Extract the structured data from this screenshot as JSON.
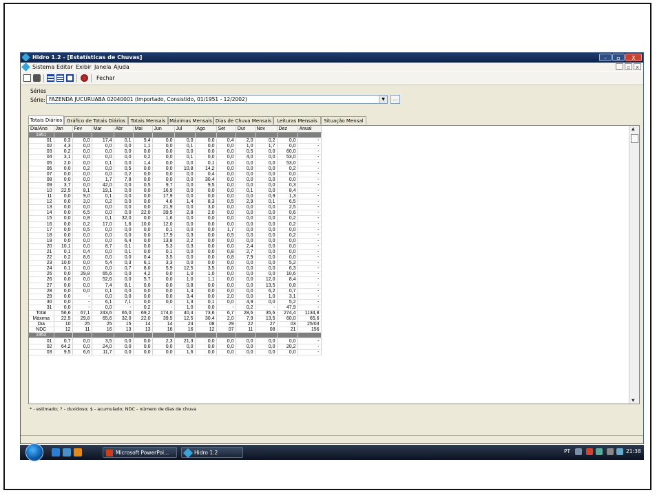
{
  "window": {
    "title": "Hidro 1.2 - [Estatísticas de Chuvas]",
    "controls": {
      "minimize": "–",
      "maximize": "▫",
      "close": "X"
    }
  },
  "menu": {
    "items": [
      "Sistema",
      "Editar",
      "Exibir",
      "Janela",
      "Ajuda"
    ],
    "mdi_controls": [
      "_",
      "▫",
      "x"
    ]
  },
  "toolbar": {
    "icons": [
      "preview-icon",
      "print-icon",
      "copy-icon",
      "grid-icon",
      "columns-icon",
      "chart-icon"
    ],
    "fechar_label": "Fechar"
  },
  "series": {
    "group_label": "Séries",
    "serie_label": "Série:",
    "serie_value": "FAZENDA JUCURUABA 02040001 (Importado, Consistido, 01/1951 - 12/2002)",
    "browse_label": "..."
  },
  "tabs": [
    "Totais Diários",
    "Gráfico de Totais Diários",
    "Totais Mensais",
    "Máximas Mensais",
    "Dias de Chuva Mensais",
    "Leituras Mensais",
    "Situação Mensal"
  ],
  "active_tab": 0,
  "table": {
    "headers": [
      "Dia/Ano",
      "Jan",
      "Fev",
      "Mar",
      "Abr",
      "Mai",
      "Jun",
      "Jul",
      "Ago",
      "Set",
      "Out",
      "Nov",
      "Dez",
      "Anual"
    ],
    "year1": "1951",
    "year1_rows": [
      [
        "01",
        "0,3",
        "0,0",
        "17,4",
        "0,1",
        "9,4",
        "0,0",
        "0,0",
        "0,0",
        "0,4",
        "2,0",
        "0,2",
        "0,0",
        "-"
      ],
      [
        "02",
        "4,3",
        "0,0",
        "0,0",
        "0,0",
        "1,1",
        "0,0",
        "0,1",
        "0,0",
        "0,0",
        "1,0",
        "1,7",
        "0,0",
        "-"
      ],
      [
        "03",
        "0,2",
        "0,0",
        "0,0",
        "0,0",
        "0,0",
        "0,0",
        "0,0",
        "0,0",
        "0,0",
        "0,5",
        "0,0",
        "60,0",
        "-"
      ],
      [
        "04",
        "3,1",
        "0,0",
        "0,0",
        "0,0",
        "0,2",
        "0,0",
        "0,1",
        "0,0",
        "0,0",
        "4,0",
        "0,0",
        "53,0",
        "-"
      ],
      [
        "05",
        "2,0",
        "0,0",
        "0,1",
        "0,0",
        "1,4",
        "0,0",
        "0,0",
        "0,1",
        "0,0",
        "0,0",
        "0,0",
        "53,0",
        "-"
      ],
      [
        "06",
        "0,0",
        "0,2",
        "0,0",
        "0,5",
        "0,0",
        "0,0",
        "10,8",
        "14,2",
        "0,0",
        "0,0",
        "0,0",
        "0,2",
        "-"
      ],
      [
        "07",
        "0,0",
        "0,0",
        "0,0",
        "0,2",
        "0,0",
        "0,0",
        "0,0",
        "0,4",
        "0,0",
        "0,0",
        "0,0",
        "0,0",
        "-"
      ],
      [
        "08",
        "0,0",
        "0,0",
        "1,7",
        "7,8",
        "0,0",
        "0,0",
        "0,0",
        "30,4",
        "0,0",
        "0,0",
        "0,0",
        "0,0",
        "-"
      ],
      [
        "09",
        "3,7",
        "0,0",
        "42,0",
        "0,0",
        "0,5",
        "9,7",
        "0,0",
        "9,5",
        "0,0",
        "0,0",
        "0,0",
        "0,3",
        "-"
      ],
      [
        "10",
        "22,5",
        "8,1",
        "19,1",
        "0,0",
        "0,0",
        "16,9",
        "0,0",
        "0,0",
        "0,0",
        "0,1",
        "0,0",
        "8,4",
        "-"
      ],
      [
        "11",
        "0,0",
        "9,0",
        "0,1",
        "0,0",
        "0,0",
        "17,9",
        "0,0",
        "0,0",
        "0,0",
        "0,0",
        "0,9",
        "1,3",
        "-"
      ],
      [
        "12",
        "0,0",
        "3,0",
        "0,2",
        "0,0",
        "0,0",
        "4,6",
        "1,4",
        "8,3",
        "0,5",
        "2,9",
        "0,1",
        "6,5",
        "-"
      ],
      [
        "13",
        "0,0",
        "0,0",
        "0,0",
        "0,0",
        "0,0",
        "21,9",
        "0,0",
        "3,0",
        "0,0",
        "0,0",
        "0,0",
        "2,5",
        "-"
      ],
      [
        "14",
        "0,0",
        "6,5",
        "0,0",
        "0,0",
        "22,0",
        "39,5",
        "2,8",
        "2,0",
        "0,0",
        "0,0",
        "0,0",
        "0,6",
        "-"
      ],
      [
        "15",
        "0,0",
        "0,8",
        "0,1",
        "32,0",
        "0,0",
        "1,6",
        "0,0",
        "0,0",
        "0,0",
        "0,0",
        "0,0",
        "0,2",
        "-"
      ],
      [
        "16",
        "0,0",
        "0,2",
        "17,0",
        "1,6",
        "10,0",
        "12,0",
        "0,0",
        "0,0",
        "0,0",
        "0,0",
        "0,0",
        "0,2",
        "-"
      ],
      [
        "17",
        "0,0",
        "0,5",
        "0,0",
        "0,0",
        "0,0",
        "0,1",
        "0,0",
        "0,0",
        "1,7",
        "0,0",
        "0,0",
        "0,0",
        "-"
      ],
      [
        "18",
        "0,0",
        "0,0",
        "0,0",
        "0,0",
        "0,0",
        "17,9",
        "0,3",
        "0,0",
        "0,5",
        "0,0",
        "0,0",
        "0,2",
        "-"
      ],
      [
        "19",
        "0,0",
        "0,0",
        "0,0",
        "6,4",
        "0,0",
        "13,8",
        "2,2",
        "0,0",
        "0,0",
        "0,0",
        "0,0",
        "0,0",
        "-"
      ],
      [
        "20",
        "10,1",
        "0,0",
        "8,7",
        "0,1",
        "0,0",
        "5,3",
        "0,3",
        "0,0",
        "0,0",
        "2,4",
        "0,0",
        "0,0",
        "-"
      ],
      [
        "21",
        "0,1",
        "0,4",
        "0,0",
        "0,1",
        "0,0",
        "0,1",
        "0,0",
        "0,0",
        "0,8",
        "2,7",
        "0,0",
        "0,0",
        "-"
      ],
      [
        "22",
        "0,2",
        "8,6",
        "0,0",
        "0,0",
        "0,4",
        "3,5",
        "0,0",
        "0,0",
        "0,8",
        "7,9",
        "0,0",
        "0,0",
        "-"
      ],
      [
        "23",
        "10,0",
        "0,0",
        "5,4",
        "0,3",
        "6,1",
        "3,3",
        "0,0",
        "0,0",
        "0,0",
        "0,0",
        "0,0",
        "5,2",
        "-"
      ],
      [
        "24",
        "0,1",
        "0,0",
        "0,0",
        "0,7",
        "8,0",
        "5,9",
        "12,5",
        "3,5",
        "0,0",
        "0,0",
        "0,0",
        "6,3",
        "-"
      ],
      [
        "25",
        "0,0",
        "29,8",
        "65,6",
        "0,0",
        "4,2",
        "0,0",
        "1,0",
        "1,0",
        "0,0",
        "0,0",
        "0,0",
        "10,6",
        "-"
      ],
      [
        "26",
        "0,0",
        "0,0",
        "52,6",
        "0,0",
        "5,7",
        "0,0",
        "1,0",
        "1,1",
        "0,0",
        "0,0",
        "12,0",
        "8,4",
        "-"
      ],
      [
        "27",
        "0,0",
        "0,0",
        "7,4",
        "8,1",
        "0,0",
        "0,0",
        "0,8",
        "0,0",
        "0,0",
        "0,0",
        "13,5",
        "0,8",
        "-"
      ],
      [
        "28",
        "0,0",
        "0,0",
        "0,1",
        "0,0",
        "0,0",
        "0,0",
        "1,4",
        "0,0",
        "0,0",
        "0,0",
        "6,2",
        "0,7",
        "-"
      ],
      [
        "29",
        "0,0",
        "-",
        "0,0",
        "0,0",
        "0,0",
        "0,0",
        "3,4",
        "0,0",
        "2,0",
        "0,0",
        "1,0",
        "3,1",
        "-"
      ],
      [
        "30",
        "0,0",
        "-",
        "6,1",
        "7,1",
        "0,0",
        "0,0",
        "1,3",
        "0,1",
        "0,0",
        "4,9",
        "0,0",
        "5,2",
        "-"
      ],
      [
        "31",
        "0,0",
        "-",
        "0,0",
        "-",
        "0,2",
        "-",
        "1,0",
        "0,0",
        "-",
        "0,2",
        "-",
        "47,9",
        "-"
      ]
    ],
    "summary_rows": [
      [
        "Total",
        "56,6",
        "67,1",
        "243,6",
        "65,0",
        "69,2",
        "174,0",
        "40,4",
        "73,6",
        "6,7",
        "28,6",
        "35,6",
        "274,4",
        "1134,8"
      ],
      [
        "Máxima",
        "22,5",
        "29,8",
        "65,6",
        "32,0",
        "22,0",
        "39,5",
        "12,5",
        "30,4",
        "2,0",
        "7,9",
        "13,5",
        "60,0",
        "65,6"
      ],
      [
        "Dia",
        "10",
        "25",
        "25",
        "15",
        "14",
        "14",
        "24",
        "08",
        "29",
        "22",
        "27",
        "03",
        "25/03"
      ],
      [
        "NDC",
        "12",
        "11",
        "16",
        "13",
        "13",
        "16",
        "16",
        "12",
        "07",
        "11",
        "08",
        "21",
        "156"
      ]
    ],
    "year2": "1952",
    "year2_rows": [
      [
        "01",
        "0,7",
        "0,0",
        "3,5",
        "0,0",
        "0,0",
        "2,3",
        "21,3",
        "0,0",
        "0,0",
        "0,0",
        "0,0",
        "0,0",
        "-"
      ],
      [
        "02",
        "64,2",
        "0,0",
        "24,0",
        "0,0",
        "0,0",
        "0,0",
        "0,0",
        "0,0",
        "0,0",
        "0,0",
        "0,0",
        "20,2",
        "-"
      ],
      [
        "03",
        "9,5",
        "6,6",
        "11,7",
        "0,0",
        "0,0",
        "0,0",
        "1,6",
        "0,0",
        "0,0",
        "0,0",
        "0,0",
        "0,0",
        "-"
      ]
    ]
  },
  "legend": "* - estimado; ? - duvidoso; $ - acumulado; NDC - número de dias de chuva",
  "taskbar": {
    "tasks": [
      "Microsoft PowerPoi...",
      "Hidro 1.2"
    ],
    "tray_lang": "PT",
    "clock": "21:38"
  },
  "colors": {
    "titlebar": "#0f2248",
    "year_row": "#7f7f7f",
    "window_bg": "#ece9d8"
  }
}
